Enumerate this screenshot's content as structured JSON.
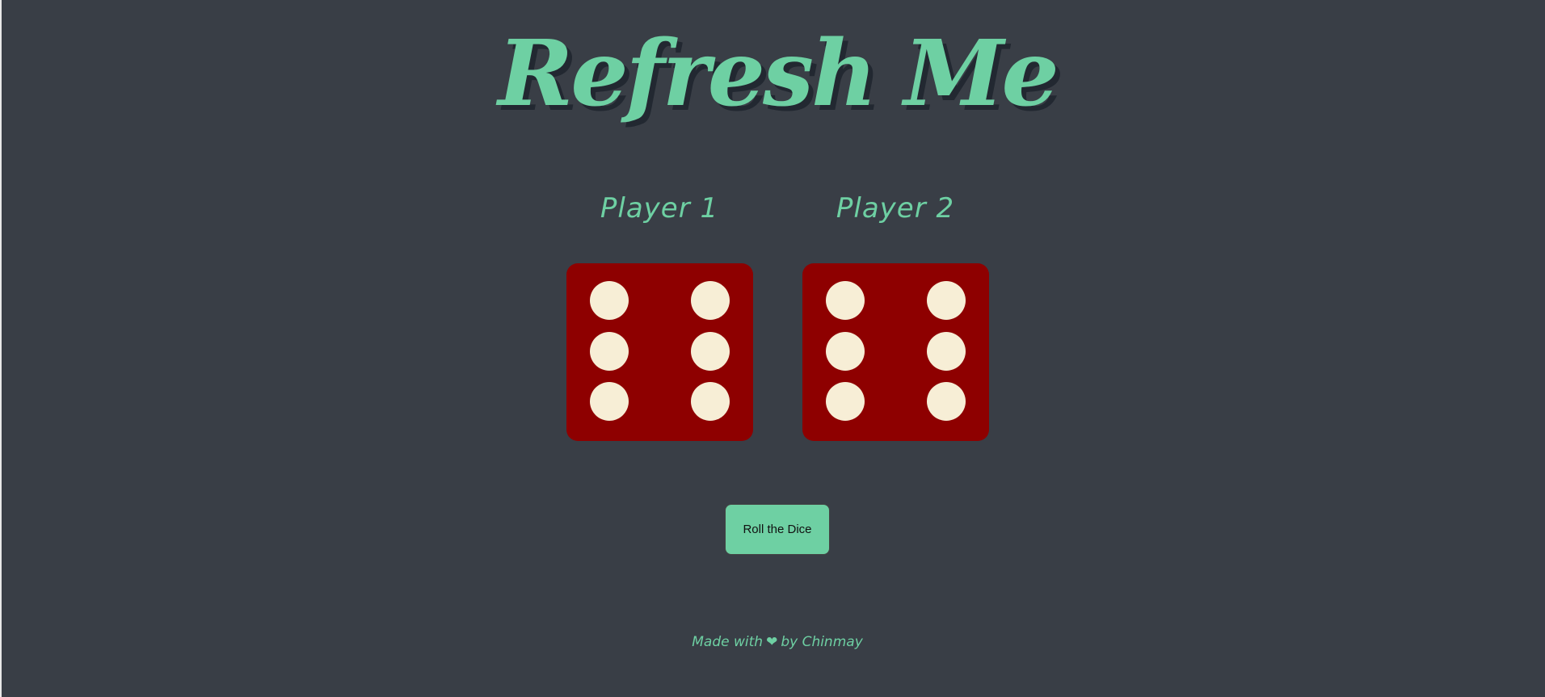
{
  "title": "Refresh Me",
  "players": [
    {
      "label": "Player 1",
      "die_value": 6
    },
    {
      "label": "Player 2",
      "die_value": 6
    }
  ],
  "roll_button_label": "Roll the Dice",
  "footer": {
    "prefix": "Made with",
    "icon": "heart-icon",
    "suffix": "by Chinmay"
  },
  "colors": {
    "background": "#393e46",
    "accent": "#6ed0a3",
    "die": "#8e0000",
    "pip": "#f7eed6"
  }
}
